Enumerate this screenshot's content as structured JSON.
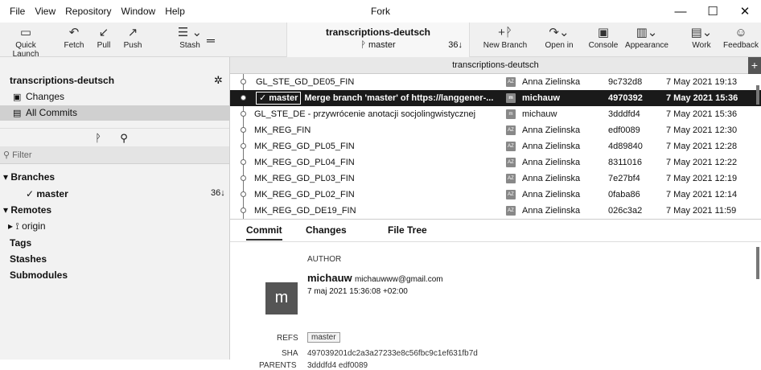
{
  "menu": [
    "File",
    "View",
    "Repository",
    "Window",
    "Help"
  ],
  "app_title": "Fork",
  "window_controls": {
    "minimize": "—",
    "maximize": "☐",
    "close": "✕"
  },
  "toolbar": {
    "quick_launch": "Quick Launch",
    "fetch": "Fetch",
    "pull": "Pull",
    "push": "Push",
    "stash": "Stash",
    "repo": "transcriptions-deutsch",
    "branch": "master",
    "count": "36↓",
    "new_branch": "New Branch",
    "open_in": "Open in",
    "console": "Console",
    "appearance": "Appearance",
    "work": "Work",
    "feedback": "Feedback"
  },
  "tab_title": "transcriptions-deutsch",
  "sidebar": {
    "repo": "transcriptions-deutsch",
    "changes": "Changes",
    "all_commits": "All Commits",
    "filter_placeholder": "Filter",
    "branches": "Branches",
    "branch_master": "✓ master",
    "branch_count": "36↓",
    "remotes": "Remotes",
    "origin": "origin",
    "tags": "Tags",
    "stashes": "Stashes",
    "submodules": "Submodules"
  },
  "commits": [
    {
      "msg": "GL_STE_GD_DE05_FIN",
      "av": "AZ",
      "author": "Anna Zielinska",
      "sha": "9c732d8",
      "date": "7 May 2021 19:13"
    },
    {
      "badge": "✓ master",
      "msg": "Merge branch 'master' of https://langgener-...",
      "av": "m",
      "author": "michauw",
      "sha": "4970392",
      "date": "7 May 2021 15:36"
    },
    {
      "msg": "GL_STE_DE - przywrócenie anotacji socjolingwistycznej",
      "av": "m",
      "author": "michauw",
      "sha": "3dddfd4",
      "date": "7 May 2021 15:36"
    },
    {
      "msg": "MK_REG_FIN",
      "av": "AZ",
      "author": "Anna Zielinska",
      "sha": "edf0089",
      "date": "7 May 2021 12:30"
    },
    {
      "msg": "MK_REG_GD_PL05_FIN",
      "av": "AZ",
      "author": "Anna Zielinska",
      "sha": "4d89840",
      "date": "7 May 2021 12:28"
    },
    {
      "msg": "MK_REG_GD_PL04_FIN",
      "av": "AZ",
      "author": "Anna Zielinska",
      "sha": "8311016",
      "date": "7 May 2021 12:22"
    },
    {
      "msg": "MK_REG_GD_PL03_FIN",
      "av": "AZ",
      "author": "Anna Zielinska",
      "sha": "7e27bf4",
      "date": "7 May 2021 12:19"
    },
    {
      "msg": "MK_REG_GD_PL02_FIN",
      "av": "AZ",
      "author": "Anna Zielinska",
      "sha": "0faba86",
      "date": "7 May 2021 12:14"
    },
    {
      "msg": "MK_REG_GD_DE19_FIN",
      "av": "AZ",
      "author": "Anna Zielinska",
      "sha": "026c3a2",
      "date": "7 May 2021 11:59"
    }
  ],
  "details": {
    "tabs": [
      "Commit",
      "Changes",
      "File Tree"
    ],
    "author_label": "AUTHOR",
    "avatar_letter": "m",
    "author_name": "michauw",
    "author_email": "michauwww@gmail.com",
    "author_date": "7 maj 2021 15:36:08 +02:00",
    "refs_label": "REFS",
    "refs_value": "master",
    "sha_label": "SHA",
    "sha_value": "497039201dc2a3a27233e8c56fbc9c1ef631fb7d",
    "parents_label": "PARENTS",
    "parents_value": "3dddfd4 edf0089"
  }
}
